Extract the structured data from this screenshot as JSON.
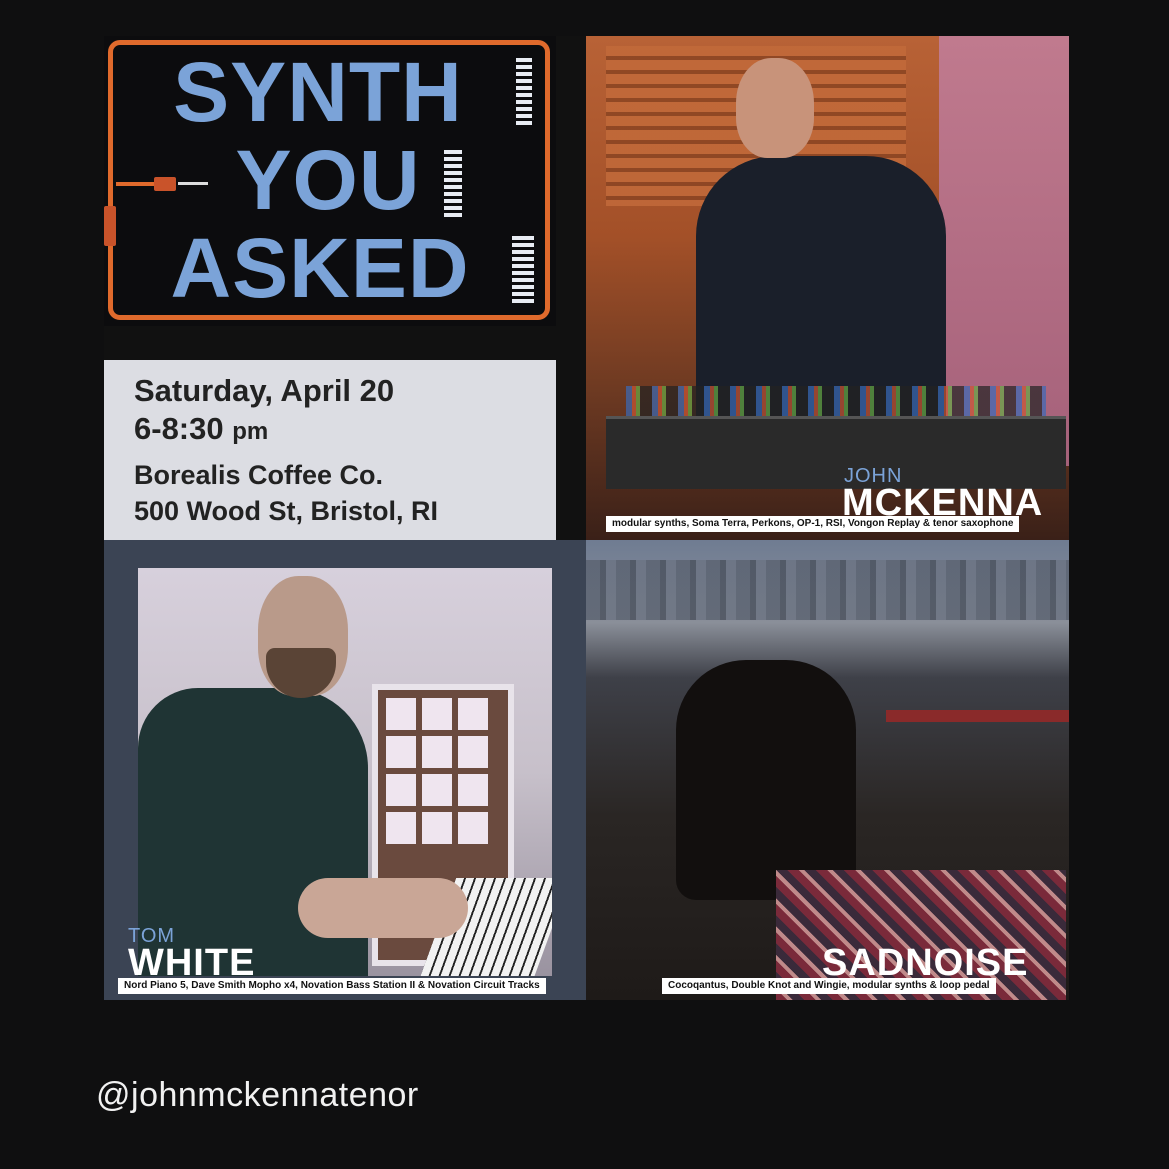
{
  "logo": {
    "line1": "SYNTH",
    "line2": "YOU",
    "line3": "ASKED",
    "colors": {
      "text": "#7ba3d8",
      "frame": "#e06a2c",
      "keys": "#e8ecf3"
    }
  },
  "event": {
    "date": "Saturday, April 20",
    "time": "6-8:30",
    "time_suffix": "pm",
    "venue": "Borealis Coffee Co.",
    "address": "500 Wood St, Bristol, RI"
  },
  "performers": {
    "john": {
      "first": "JOHN",
      "last": "MCKENNA",
      "gear": "modular synths, Soma Terra, Perkons, OP-1, RSI, Vongon Replay & tenor saxophone"
    },
    "tom": {
      "first": "TOM",
      "last": "WHITE",
      "gear": "Nord Piano 5, Dave Smith Mopho x4, Novation Bass Station II & Novation Circuit Tracks"
    },
    "sad": {
      "last": "SADNOISE",
      "gear": "Cocoqantus, Double Knot and Wingie, modular synths & loop pedal"
    }
  },
  "footer": {
    "handle": "@johnmckennatenor"
  }
}
